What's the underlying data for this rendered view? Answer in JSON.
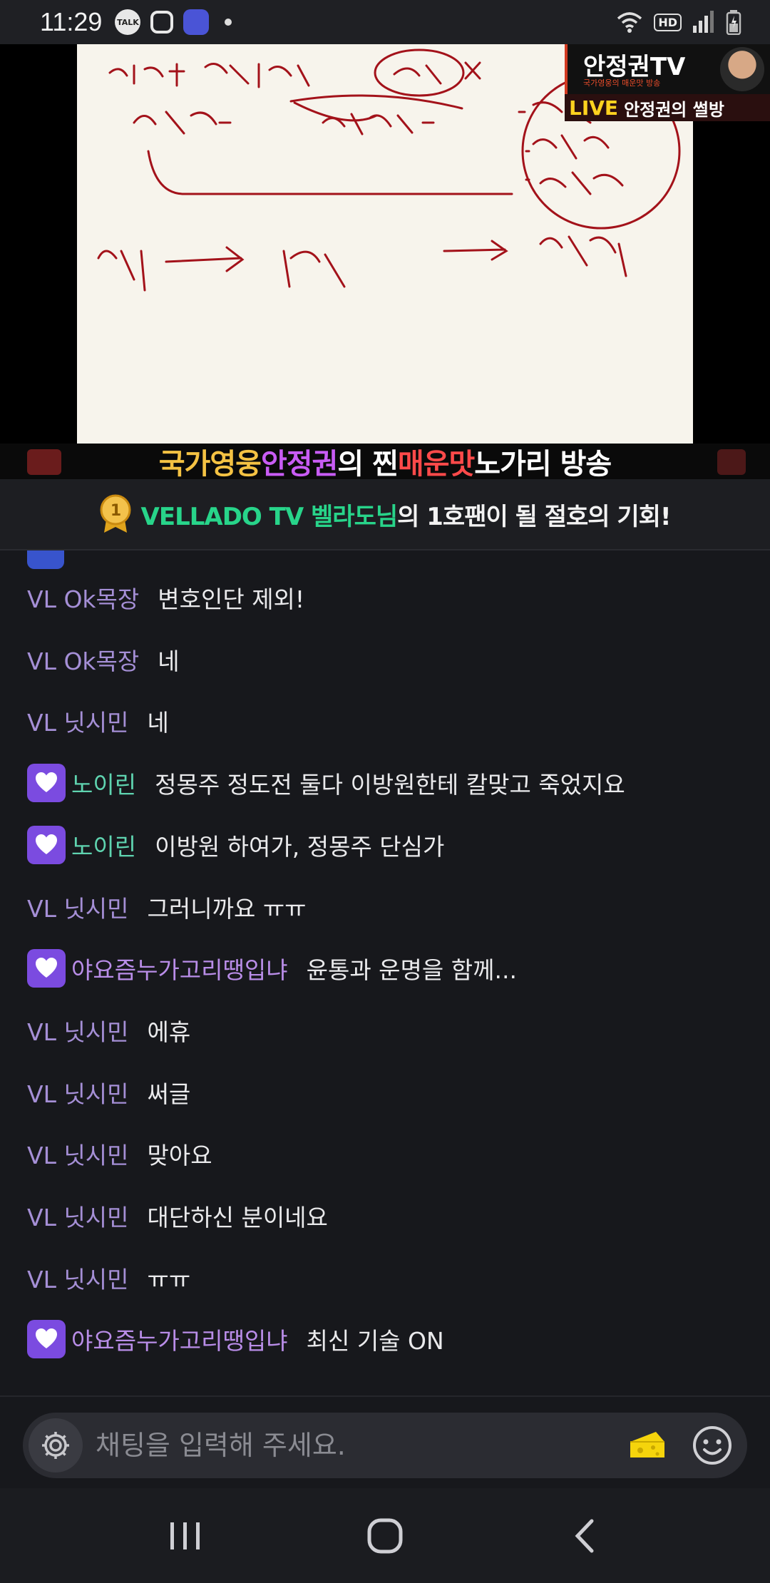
{
  "status_bar": {
    "time": "11:29",
    "talk_label": "TALK",
    "hd_label": "HD"
  },
  "video": {
    "logo_title": "안정권TV",
    "logo_subtitle": "국가영웅의 매운맛 방송",
    "live_badge": "LIVE",
    "live_title": "안정권의 썰방",
    "caption": {
      "part1": "국가영웅 ",
      "part2": "안정권",
      "part3": "의 찐 ",
      "part4": "매운맛",
      "part5": " 노가리 방송"
    }
  },
  "banner": {
    "medal_number": "1",
    "highlight": "VELLADO TV 벨라도님",
    "rest": "의 1호팬이 될 절호의 기회!"
  },
  "chat": {
    "messages": [
      {
        "nick": "VL Ok목장",
        "text": "변호인단 제외!",
        "badge": "none",
        "nick_color": "vl"
      },
      {
        "nick": "VL Ok목장",
        "text": "네",
        "badge": "none",
        "nick_color": "vl"
      },
      {
        "nick": "VL 닛시민",
        "text": "네",
        "badge": "none",
        "nick_color": "vl"
      },
      {
        "nick": "노이린",
        "text": "정몽주 정도전 둘다 이방원한테 칼맞고 죽었지요",
        "badge": "heart",
        "nick_color": "green"
      },
      {
        "nick": "노이린",
        "text": "이방원 하여가, 정몽주 단심가",
        "badge": "heart",
        "nick_color": "green"
      },
      {
        "nick": "VL 닛시민",
        "text": "그러니까요 ㅠㅠ",
        "badge": "none",
        "nick_color": "vl"
      },
      {
        "nick": "야요즘누가고리땡입냐",
        "text": "윤통과 운명을 함께...",
        "badge": "heart",
        "nick_color": "purple"
      },
      {
        "nick": "VL 닛시민",
        "text": "에휴",
        "badge": "none",
        "nick_color": "vl"
      },
      {
        "nick": "VL 닛시민",
        "text": "써글",
        "badge": "none",
        "nick_color": "vl"
      },
      {
        "nick": "VL 닛시민",
        "text": "맞아요",
        "badge": "none",
        "nick_color": "vl"
      },
      {
        "nick": "VL 닛시민",
        "text": "대단하신 분이네요",
        "badge": "none",
        "nick_color": "vl"
      },
      {
        "nick": "VL 닛시민",
        "text": "ㅠㅠ",
        "badge": "none",
        "nick_color": "vl"
      },
      {
        "nick": "야요즘누가고리땡입냐",
        "text": "최신 기술 ON",
        "badge": "heart",
        "nick_color": "purple"
      }
    ]
  },
  "input": {
    "placeholder": "채팅을 입력해 주세요."
  },
  "colors": {
    "accent_purple": "#7b4be0",
    "banner_green": "#28d48a",
    "live_yellow": "#ffd21f"
  }
}
